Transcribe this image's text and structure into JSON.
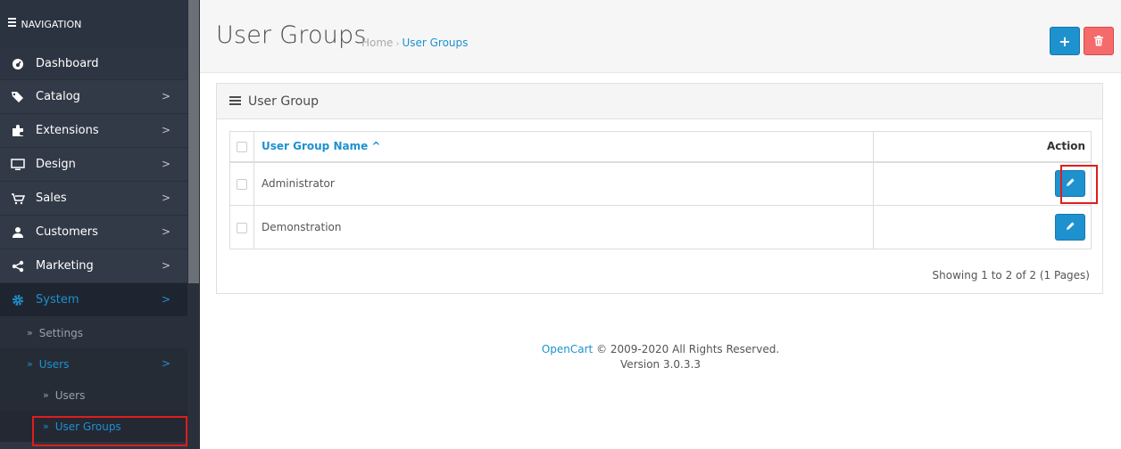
{
  "sidebar": {
    "heading": "NAVIGATION",
    "items": [
      {
        "label": "Dashboard",
        "icon": "dashboard-icon"
      },
      {
        "label": "Catalog",
        "icon": "tag-icon"
      },
      {
        "label": "Extensions",
        "icon": "puzzle-icon"
      },
      {
        "label": "Design",
        "icon": "monitor-icon"
      },
      {
        "label": "Sales",
        "icon": "cart-icon"
      },
      {
        "label": "Customers",
        "icon": "user-icon"
      },
      {
        "label": "Marketing",
        "icon": "share-icon"
      },
      {
        "label": "System",
        "icon": "gear-icon"
      }
    ],
    "system_sub": [
      {
        "label": "Settings"
      },
      {
        "label": "Users"
      }
    ],
    "users_sub": [
      {
        "label": "Users"
      },
      {
        "label": "User Groups"
      }
    ]
  },
  "header": {
    "title": "User Groups",
    "breadcrumb": {
      "home": "Home",
      "sep": "›",
      "current": "User Groups"
    },
    "add_symbol": "+",
    "delete_icon": "trash-icon"
  },
  "panel": {
    "title": "User Group",
    "columns": {
      "name": "User Group Name ^",
      "action": "Action"
    },
    "rows": [
      {
        "name": "Administrator"
      },
      {
        "name": "Demonstration"
      }
    ],
    "pagination_text": "Showing 1 to 2 of 2 (1 Pages)"
  },
  "footer": {
    "brand": "OpenCart",
    "rights": " © 2009-2020 All Rights Reserved.",
    "version": "Version 3.0.3.3"
  },
  "colors": {
    "accent": "#1e91cf",
    "danger": "#f56b6b",
    "sidebar_bg": "#2f3542",
    "highlight": "#e01d1d"
  }
}
